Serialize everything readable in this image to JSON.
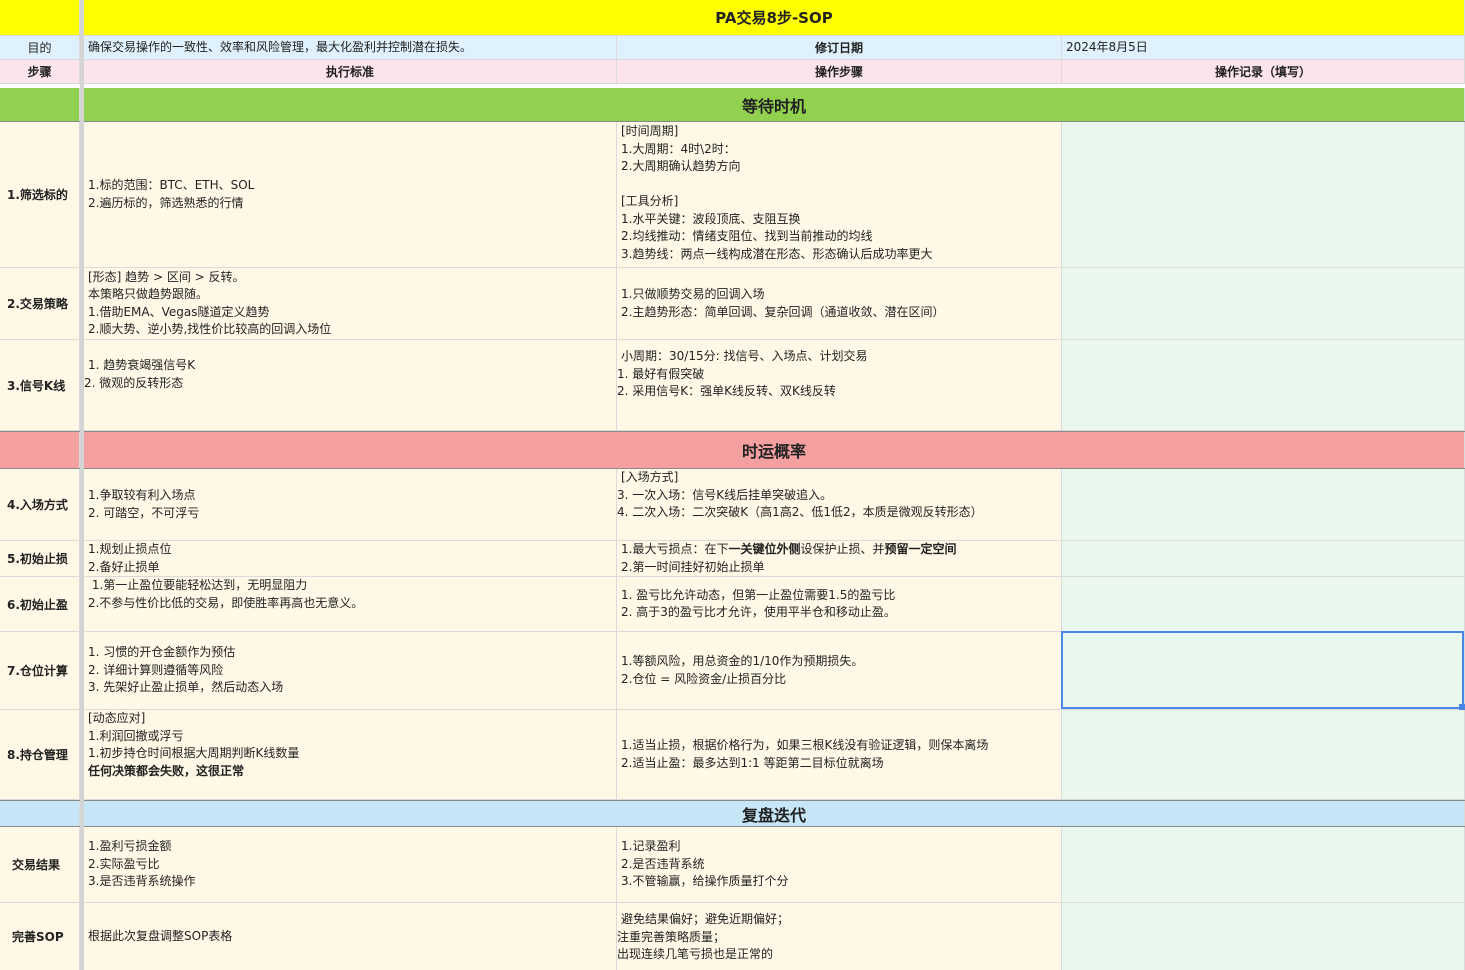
{
  "colors": {
    "title_bg": "#ffff00",
    "header_bg": "#dff1fc",
    "subheader_bg": "#fce4ec",
    "section_wait_bg": "#92d050",
    "section_prob_bg": "#f4a0a0",
    "section_review_bg": "#c6e6f7",
    "body_bg": "#fff8e6",
    "record_bg": "#eaf7ee",
    "selection": "#4a86e8"
  },
  "title": "PA交易8步-SOP",
  "meta": {
    "purpose_label": "目的",
    "purpose_text": "确保交易操作的一致性、效率和风险管理，最大化盈利并控制潜在损失。",
    "revision_label": "修订日期",
    "revision_date": "2024年8月5日"
  },
  "columns": {
    "step": "步骤",
    "standard": "执行标准",
    "operation": "操作步骤",
    "record": "操作记录（填写）"
  },
  "sections": {
    "wait": "等待时机",
    "prob": "时运概率",
    "review": "复盘迭代"
  },
  "rows": [
    {
      "step": "1.筛选标的",
      "standard": "1.标的范围：BTC、ETH、SOL\n2.遍历标的，筛选熟悉的行情",
      "operation": "[时间周期]\n1.大周期：4时\\2时：\n2.大周期确认趋势方向\n\n[工具分析]\n1.水平关键：波段顶底、支阻互换\n2.均线推动：情绪支阻位、找到当前推动的均线\n3.趋势线：两点一线构成潜在形态、形态确认后成功率更大",
      "record": ""
    },
    {
      "step": "2.交易策略",
      "standard": "[形态] 趋势 > 区间 > 反转。\n本策略只做趋势跟随。\n1.借助EMA、Vegas隧道定义趋势\n2.顺大势、逆小势,找性价比较高的回调入场位",
      "operation": "1.只做顺势交易的回调入场\n2.主趋势形态：简单回调、复杂回调（通道收敛、潜在区间）",
      "record": ""
    },
    {
      "step": "3.信号K线",
      "standard": "1. 趋势衰竭强信号K\n2. 微观的反转形态",
      "operation": "小周期：30/15分: 找信号、入场点、计划交易\n1. 最好有假突破\n2. 采用信号K：强单K线反转、双K线反转",
      "record": ""
    },
    {
      "step": "4.入场方式",
      "standard": "1.争取较有利入场点\n2. 可踏空，不可浮亏",
      "operation": "[入场方式]\n3. 一次入场：信号K线后挂单突破追入。\n4. 二次入场：二次突破K（高1高2、低1低2，本质是微观反转形态）",
      "record": ""
    },
    {
      "step": "5.初始止损",
      "standard": "1.规划止损点位\n2.备好止损单",
      "operation_a": "1.最大亏损点：在下",
      "operation_b": "一关键位外侧",
      "operation_c": "设保护止损、并",
      "operation_d": "预留一定空间",
      "operation_e": "2.第一时间挂好初始止损单",
      "record": ""
    },
    {
      "step": "6.初始止盈",
      "standard": " 1.第一止盈位要能轻松达到，无明显阻力\n 2.不参与性价比低的交易，即使胜率再高也无意义。",
      "operation": "1. 盈亏比允许动态，但第一止盈位需要1.5的盈亏比\n2. 高于3的盈亏比才允许，使用平半仓和移动止盈。",
      "record": ""
    },
    {
      "step": "7.仓位计算",
      "standard": "1. 习惯的开仓金额作为预估\n2. 详细计算则遵循等风险\n3. 先架好止盈止损单，然后动态入场",
      "operation": "1.等额风险，用总资金的1/10作为预期损失。\n2.仓位 = 风险资金/止损百分比",
      "record": ""
    },
    {
      "step": "8.持仓管理",
      "standard": "[动态应对]\n1.利润回撤或浮亏\n1.初步持仓时间根据大周期判断K线数量\n",
      "standard_bold": "任何决策都会失败，这很正常",
      "operation": "1.适当止损，根据价格行为，如果三根K线没有验证逻辑，则保本离场\n2.适当止盈：最多达到1:1 等距第二目标位就离场",
      "record": ""
    },
    {
      "step": "交易结果",
      "standard": "1.盈利亏损金额\n2.实际盈亏比\n3.是否违背系统操作",
      "operation": "1.记录盈利\n2.是否违背系统\n3.不管输赢，给操作质量打个分",
      "record": ""
    },
    {
      "step": "完善SOP",
      "standard": "根据此次复盘调整SOP表格",
      "operation": "避免结果偏好；避免近期偏好；\n注重完善策略质量；\n出现连续几笔亏损也是正常的",
      "record": ""
    }
  ]
}
